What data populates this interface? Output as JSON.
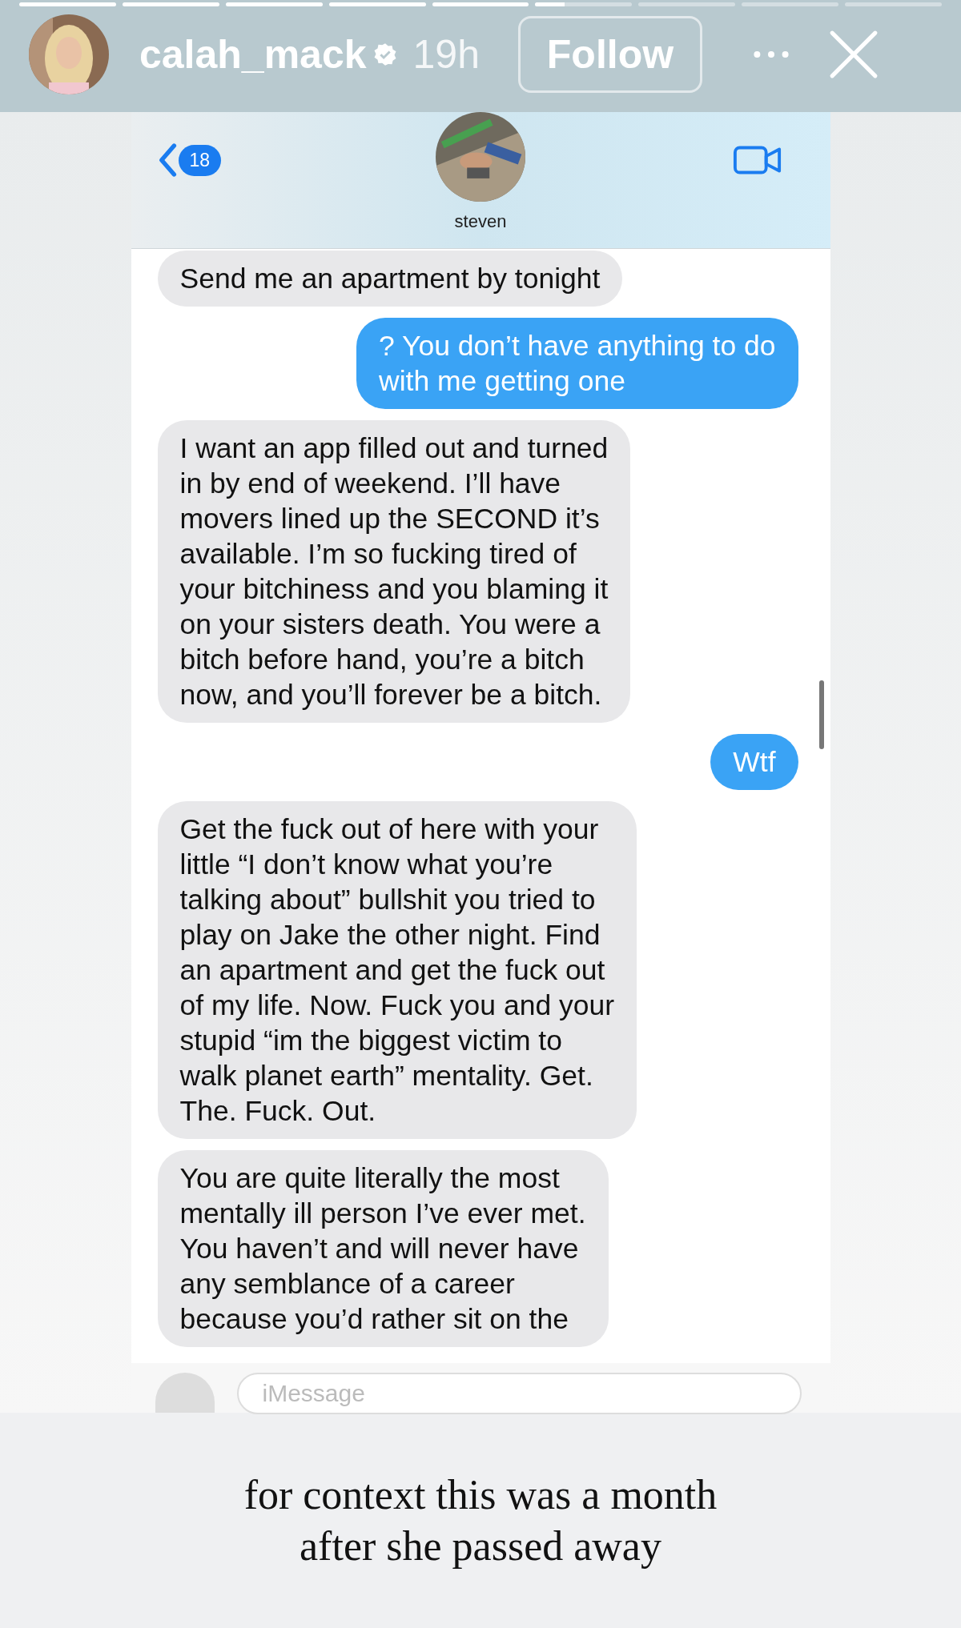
{
  "story": {
    "segments": [
      {
        "kind": "seen"
      },
      {
        "kind": "seen"
      },
      {
        "kind": "seen"
      },
      {
        "kind": "seen"
      },
      {
        "kind": "seen"
      },
      {
        "kind": "current",
        "level": 0.3
      },
      {
        "kind": "unseen"
      },
      {
        "kind": "unseen"
      },
      {
        "kind": "unseen"
      }
    ],
    "username": "calah_mack",
    "verified": true,
    "time": "19h",
    "follow_button": "Follow"
  },
  "chat": {
    "unread_count": "18",
    "contact": "steven",
    "messages": [
      {
        "kind": "incoming",
        "lines": [
          "Send me an apartment by tonight"
        ]
      },
      {
        "kind": "outgoing",
        "lines": [
          "? You don’t have anything to do",
          "with me getting one"
        ]
      },
      {
        "kind": "incoming",
        "lines": [
          "I want an app filled out and turned",
          "in by end of weekend. I’ll have",
          "movers lined up the SECOND it’s",
          "available. I’m so fucking tired of",
          "your bitchiness and you blaming it",
          "on your sisters death. You were a",
          "bitch before hand, you’re a bitch",
          "now, and you’ll forever be a bitch."
        ]
      },
      {
        "kind": "outgoing",
        "lines": [
          "Wtf"
        ]
      },
      {
        "kind": "incoming",
        "lines": [
          "Get the fuck out of here with your",
          "little “I don’t know what you’re",
          "talking about” bullshit you tried to",
          "play on Jake the other night. Find",
          "an apartment and get the fuck out",
          "of my life. Now. Fuck you and your",
          "stupid “im the biggest victim to",
          "walk planet earth” mentality. Get.",
          "The. Fuck. Out."
        ]
      },
      {
        "kind": "incoming",
        "lines": [
          "You are quite literally the most",
          "mentally ill person I’ve ever met.",
          "You haven’t and will never have",
          "any semblance of a career",
          "because you’d rather sit on the"
        ]
      }
    ],
    "compose": {
      "placeholder": "iMessage"
    }
  },
  "caption": [
    "for context this was a month",
    "after she passed away"
  ]
}
